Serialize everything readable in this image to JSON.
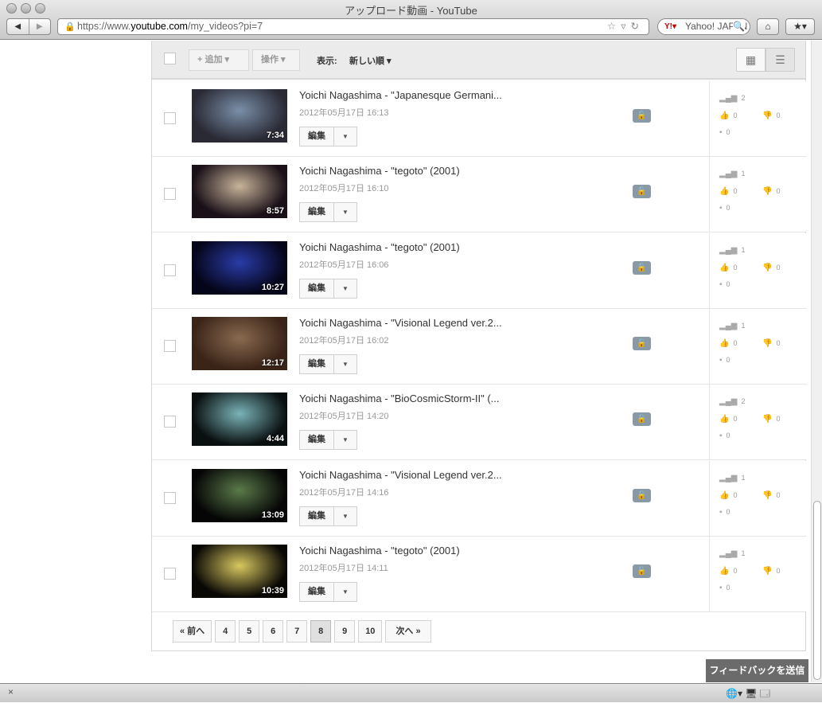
{
  "window": {
    "title": "アップロード動画 - YouTube"
  },
  "browser": {
    "url_prefix": "https://www.",
    "url_domain": "youtube.com",
    "url_path": "/my_videos?pi=7",
    "search_text": "Yahoo! JAPAN"
  },
  "toolbar": {
    "add_label": "+ 追加",
    "actions_label": "操作",
    "view_label": "表示:",
    "sort_label": "新しい順"
  },
  "videos": [
    {
      "title": "Yoichi Nagashima - \"Japanesque Germani...",
      "date": "2012年05月17日 16:13",
      "duration": "7:34",
      "views": "2",
      "likes": "0",
      "dislikes": "0",
      "comments": "0",
      "thumb": [
        "#2a2a35",
        "#7a8fa8"
      ]
    },
    {
      "title": "Yoichi Nagashima - \"tegoto\" (2001)",
      "date": "2012年05月17日 16:10",
      "duration": "8:57",
      "views": "1",
      "likes": "0",
      "dislikes": "0",
      "comments": "0",
      "thumb": [
        "#1a1018",
        "#c8b49a"
      ]
    },
    {
      "title": "Yoichi Nagashima - \"tegoto\" (2001)",
      "date": "2012年05月17日 16:06",
      "duration": "10:27",
      "views": "1",
      "likes": "0",
      "dislikes": "0",
      "comments": "0",
      "thumb": [
        "#05051a",
        "#2a3ca8"
      ]
    },
    {
      "title": "Yoichi Nagashima - \"Visional Legend ver.2...",
      "date": "2012年05月17日 16:02",
      "duration": "12:17",
      "views": "1",
      "likes": "0",
      "dislikes": "0",
      "comments": "0",
      "thumb": [
        "#3a2418",
        "#8a6a50"
      ]
    },
    {
      "title": "Yoichi Nagashima - \"BioCosmicStorm-II\" (...",
      "date": "2012年05月17日 14:20",
      "duration": "4:44",
      "views": "2",
      "likes": "0",
      "dislikes": "0",
      "comments": "0",
      "thumb": [
        "#0a0f10",
        "#7ab4b8"
      ]
    },
    {
      "title": "Yoichi Nagashima - \"Visional Legend ver.2...",
      "date": "2012年05月17日 14:16",
      "duration": "13:09",
      "views": "1",
      "likes": "0",
      "dislikes": "0",
      "comments": "0",
      "thumb": [
        "#050505",
        "#5a7a4a"
      ]
    },
    {
      "title": "Yoichi Nagashima - \"tegoto\" (2001)",
      "date": "2012年05月17日 14:11",
      "duration": "10:39",
      "views": "1",
      "likes": "0",
      "dislikes": "0",
      "comments": "0",
      "thumb": [
        "#0a0805",
        "#d8c860"
      ]
    }
  ],
  "edit_label": "編集",
  "pagination": {
    "prev": "« 前へ",
    "pages": [
      "4",
      "5",
      "6",
      "7",
      "8",
      "9",
      "10"
    ],
    "current": "8",
    "next": "次へ »"
  },
  "feedback_label": "フィードバックを送信"
}
